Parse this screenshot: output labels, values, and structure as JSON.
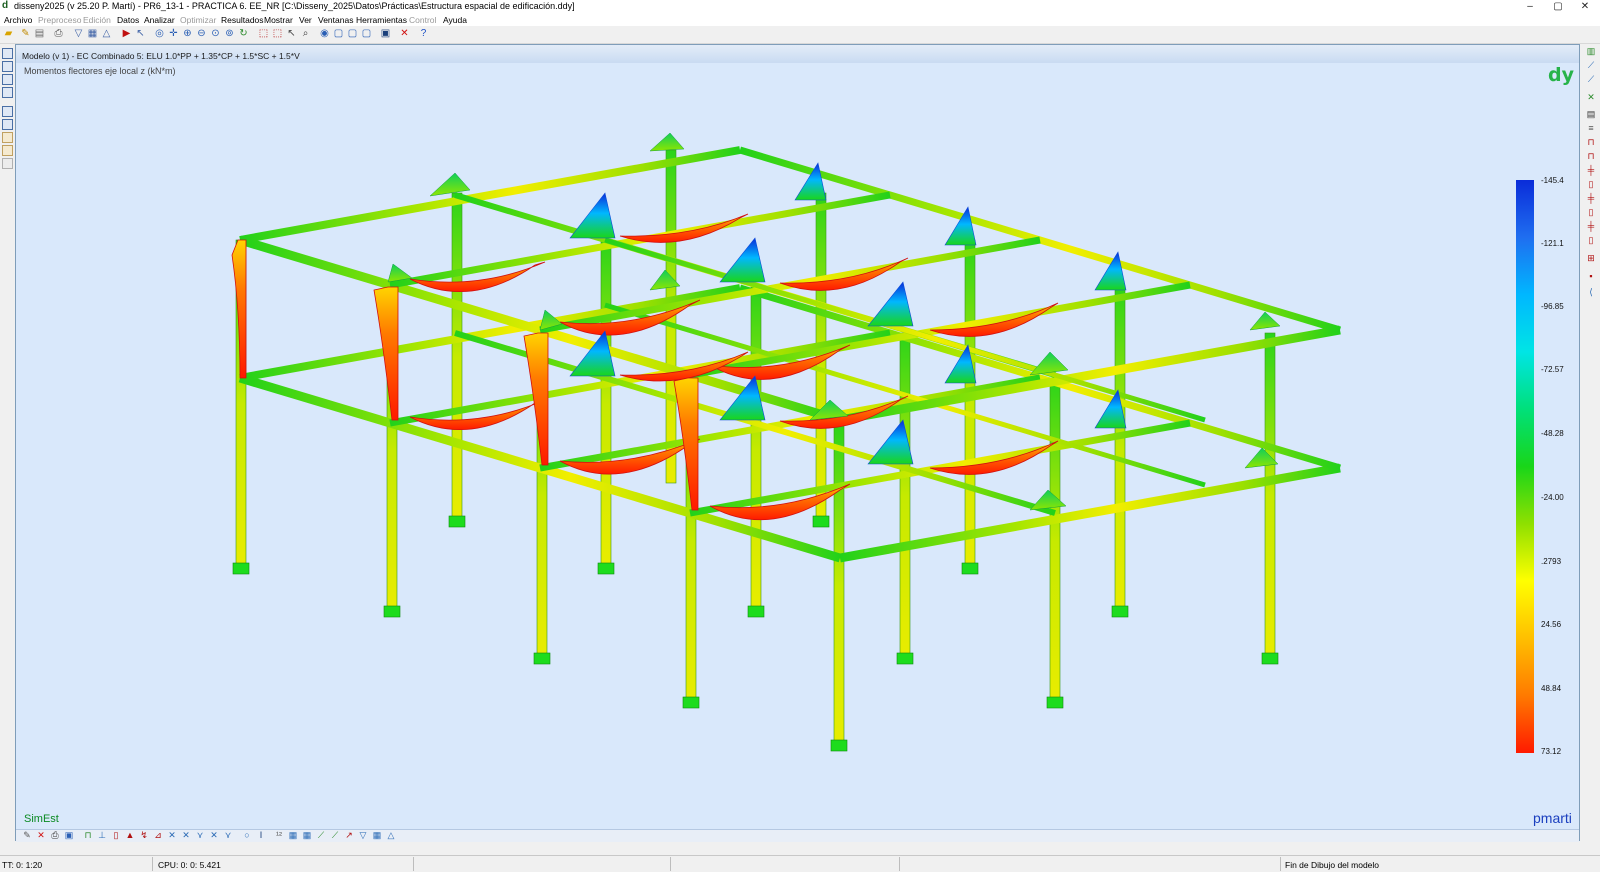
{
  "window": {
    "title": "disseny2025 (v 25.20 P. Martí) - PR6_13-1 - PRACTICA 6. EE_NR [C:\\Disseny_2025\\Datos\\Prácticas\\Estructura espacial de edificación.ddy]",
    "minimize": "–",
    "maximize": "▢",
    "close": "✕"
  },
  "menu": {
    "items": [
      {
        "label": "Archivo",
        "enabled": true
      },
      {
        "label": "Preproceso",
        "enabled": false
      },
      {
        "label": "Edición",
        "enabled": false
      },
      {
        "label": "Datos",
        "enabled": true
      },
      {
        "label": "Analizar",
        "enabled": true
      },
      {
        "label": "Optimizar",
        "enabled": false
      },
      {
        "label": "Resultados",
        "enabled": true
      },
      {
        "label": "Mostrar",
        "enabled": true
      },
      {
        "label": "Ver",
        "enabled": true
      },
      {
        "label": "Ventanas",
        "enabled": true
      },
      {
        "label": "Herramientas",
        "enabled": true
      },
      {
        "label": "Control",
        "enabled": false
      },
      {
        "label": "Ayuda",
        "enabled": true
      }
    ]
  },
  "view": {
    "title": "Modelo (v 1) - EC Combinado   5: ELU 1.0*PP + 1.35*CP + 1.5*SC + 1.5*V",
    "subtitle": "Momentos flectores eje local z (kN*m)",
    "logo": "dy",
    "watermark_left": "SimEst",
    "watermark_right": "pmarti"
  },
  "legend": {
    "labels": [
      "-145.4",
      "-121.1",
      "-96.85",
      "-72.57",
      "-48.28",
      "-24.00",
      ".2793",
      "24.56",
      "48.84",
      "73.12"
    ],
    "colors": {
      "negative_max": "#0a2cd9",
      "zero": "#ffff00",
      "positive_max": "#ff1a00",
      "frame": "#19d619"
    }
  },
  "status": {
    "tt": "TT:  0: 1:20",
    "cpu": "CPU:  0: 0: 5.421",
    "message": "Fin de Dibujo del modelo"
  }
}
